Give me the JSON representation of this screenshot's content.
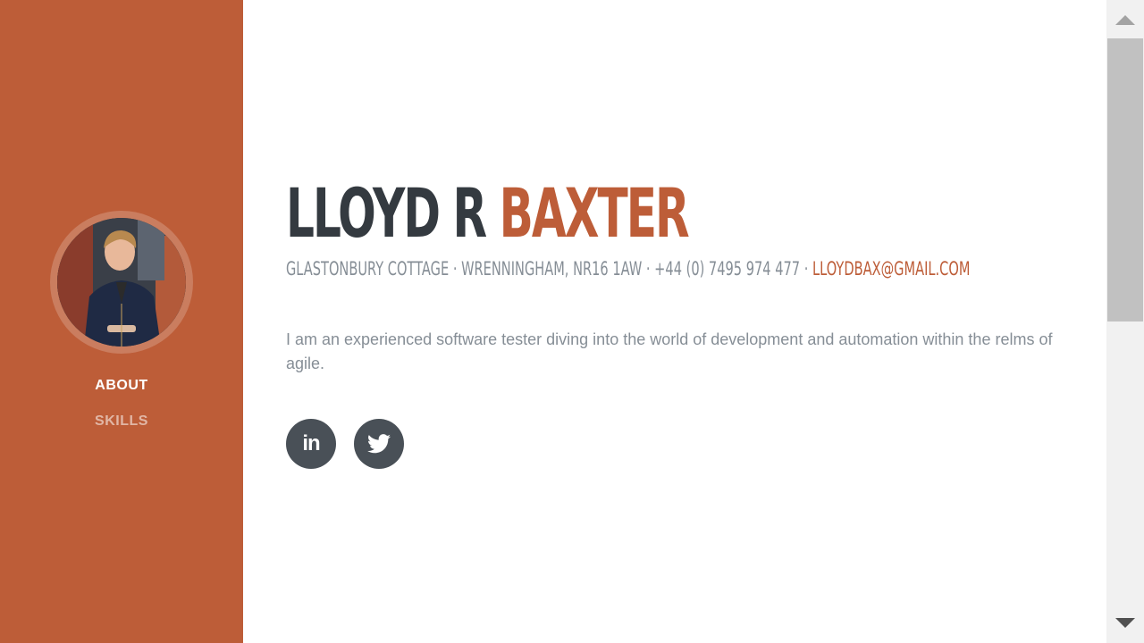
{
  "sidebar": {
    "avatar_alt": "profile photo",
    "nav": [
      {
        "label": "About"
      },
      {
        "label": "Skills"
      }
    ]
  },
  "header": {
    "first_name": "Lloyd R",
    "last_name": "Baxter"
  },
  "contact": {
    "address": "Glastonbury Cottage · Wrenningham, NR16 1AW · +44 (0) 7495 974 477 ·",
    "email": "lloydbax@gmail.com"
  },
  "about": {
    "text": "I am an experienced software tester diving into the world of development and automation within the relms of agile."
  },
  "social": [
    {
      "icon": "linkedin-icon",
      "label": "in"
    },
    {
      "icon": "twitter-icon"
    }
  ],
  "colors": {
    "accent": "#bd5d38",
    "dark": "#343a40",
    "muted": "#868e96",
    "social_bg": "#495057"
  }
}
